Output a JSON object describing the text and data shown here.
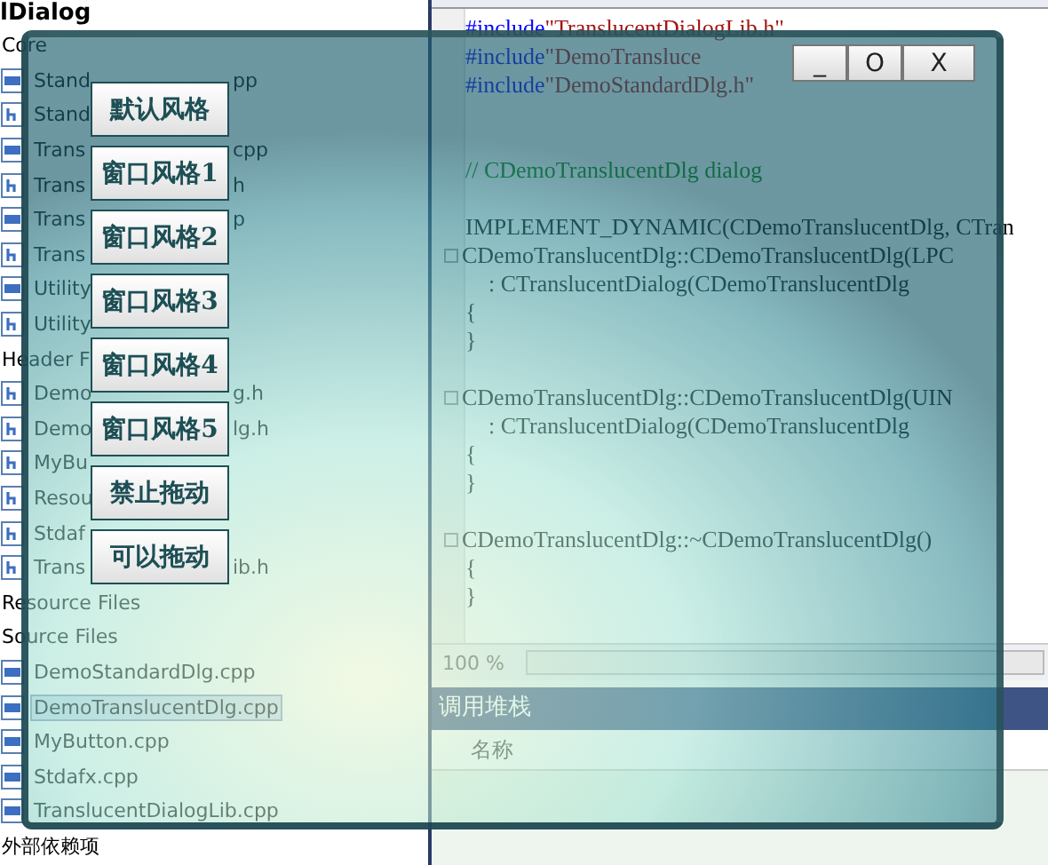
{
  "solution_explorer": {
    "title": "lDialog",
    "items": [
      {
        "kind": "folder",
        "text": "Core",
        "selected": false
      },
      {
        "kind": "cpp",
        "text": "Stand",
        "tail": "pp",
        "selected": false
      },
      {
        "kind": "h",
        "text": "Stand",
        "selected": false
      },
      {
        "kind": "cpp",
        "text": "Trans",
        "tail": "cpp",
        "selected": false
      },
      {
        "kind": "h",
        "text": "Trans",
        "tail": "h",
        "selected": false
      },
      {
        "kind": "cpp",
        "text": "Trans",
        "tail": "p",
        "selected": false
      },
      {
        "kind": "h",
        "text": "Trans",
        "selected": false
      },
      {
        "kind": "cpp",
        "text": "Utility",
        "selected": false
      },
      {
        "kind": "h",
        "text": "Utility",
        "selected": false
      },
      {
        "kind": "folder",
        "text": "Header F",
        "selected": false
      },
      {
        "kind": "h",
        "text": "Demo",
        "tail": "g.h",
        "selected": false
      },
      {
        "kind": "h",
        "text": "Demo",
        "tail": "lg.h",
        "selected": false
      },
      {
        "kind": "h",
        "text": "MyBu",
        "selected": false
      },
      {
        "kind": "h",
        "text": "Resou",
        "selected": false
      },
      {
        "kind": "h",
        "text": "Stdaf",
        "selected": false
      },
      {
        "kind": "h",
        "text": "Trans",
        "tail": "ib.h",
        "selected": false
      },
      {
        "kind": "folder",
        "text": "Resource Files",
        "selected": false
      },
      {
        "kind": "folder",
        "text": "Source Files",
        "selected": false
      },
      {
        "kind": "cpp",
        "text": "DemoStandardDlg.cpp",
        "selected": false
      },
      {
        "kind": "cpp",
        "text": "DemoTranslucentDlg.cpp",
        "selected": true
      },
      {
        "kind": "cpp",
        "text": "MyButton.cpp",
        "selected": false
      },
      {
        "kind": "cpp",
        "text": "Stdafx.cpp",
        "selected": false
      },
      {
        "kind": "cpp",
        "text": "TranslucentDialogLib.cpp",
        "selected": false
      },
      {
        "kind": "folder",
        "text": "外部依赖项",
        "selected": false
      }
    ]
  },
  "editor": {
    "lines": [
      {
        "kind": "include",
        "keyword": "#include",
        "arg": "\"TranslucentDialogLib.h\""
      },
      {
        "kind": "include",
        "keyword": "#include",
        "arg": "\"DemoTransluce"
      },
      {
        "kind": "include",
        "keyword": "#include",
        "arg": "\"DemoStandardDlg.h\""
      },
      {
        "kind": "blank"
      },
      {
        "kind": "blank"
      },
      {
        "kind": "comment",
        "text": "// CDemoTranslucentDlg dialog"
      },
      {
        "kind": "blank"
      },
      {
        "kind": "code",
        "text": "IMPLEMENT_DYNAMIC(CDemoTranslucentDlg, CTran",
        "fold": false
      },
      {
        "kind": "code",
        "text": "CDemoTranslucentDlg::CDemoTranslucentDlg(LPC",
        "fold": true
      },
      {
        "kind": "code",
        "text": "    : CTranslucentDialog(CDemoTranslucentDlg",
        "fold": false
      },
      {
        "kind": "code",
        "text": "{",
        "fold": false
      },
      {
        "kind": "code",
        "text": "}",
        "fold": false
      },
      {
        "kind": "blank"
      },
      {
        "kind": "code",
        "text": "CDemoTranslucentDlg::CDemoTranslucentDlg(UIN",
        "fold": true
      },
      {
        "kind": "code",
        "text": "    : CTranslucentDialog(CDemoTranslucentDlg",
        "fold": false
      },
      {
        "kind": "code",
        "text": "{",
        "fold": false
      },
      {
        "kind": "code",
        "text": "}",
        "fold": false
      },
      {
        "kind": "blank"
      },
      {
        "kind": "code",
        "text": "CDemoTranslucentDlg::~CDemoTranslucentDlg()",
        "fold": true
      },
      {
        "kind": "code",
        "text": "{",
        "fold": false
      },
      {
        "kind": "code",
        "text": "}",
        "fold": false
      }
    ],
    "zoom": "100 %"
  },
  "call_stack": {
    "title": "调用堆栈",
    "columns": [
      "名称"
    ]
  },
  "dialog": {
    "title_buttons": [
      "_",
      "O",
      "X"
    ],
    "buttons": [
      "默认风格",
      "窗口风格1",
      "窗口风格2",
      "窗口风格3",
      "窗口风格4",
      "窗口风格5",
      "禁止拖动",
      "可以拖动"
    ]
  }
}
